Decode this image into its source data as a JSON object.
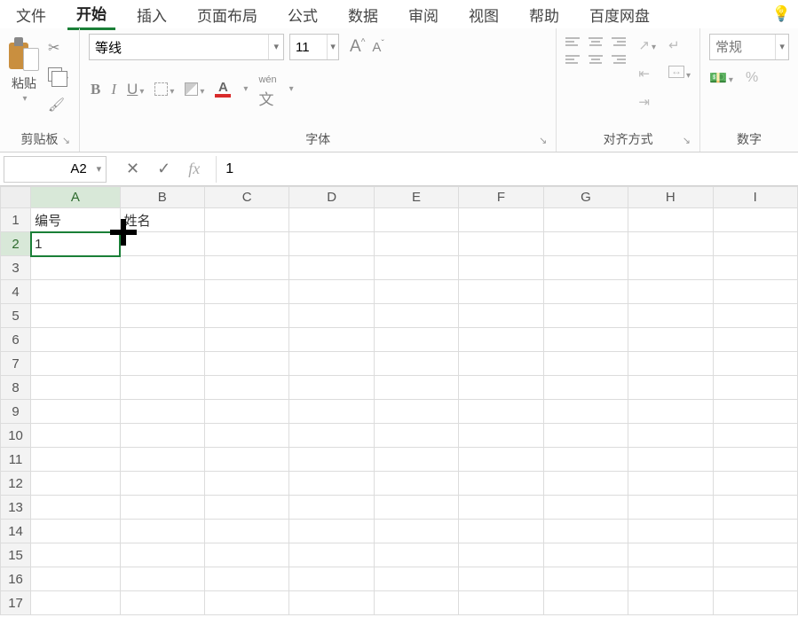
{
  "menu": {
    "tabs": [
      "文件",
      "开始",
      "插入",
      "页面布局",
      "公式",
      "数据",
      "审阅",
      "视图",
      "帮助",
      "百度网盘"
    ],
    "active_index": 1
  },
  "ribbon": {
    "clipboard": {
      "paste_label": "粘贴",
      "group_label": "剪贴板"
    },
    "font": {
      "font_name": "等线",
      "font_size": "11",
      "bold": "B",
      "italic": "I",
      "underline": "U",
      "wen": "wén",
      "group_label": "字体"
    },
    "alignment": {
      "group_label": "对齐方式"
    },
    "number": {
      "format_placeholder": "常规",
      "percent": "%",
      "group_label": "数字"
    }
  },
  "namebox": {
    "value": "A2"
  },
  "formula": {
    "value": "1",
    "cancel": "✕",
    "confirm": "✓",
    "fx": "fx"
  },
  "sheet": {
    "columns": [
      "A",
      "B",
      "C",
      "D",
      "E",
      "F",
      "G",
      "H",
      "I"
    ],
    "rows": [
      "1",
      "2",
      "3",
      "4",
      "5",
      "6",
      "7",
      "8",
      "9",
      "10",
      "11",
      "12",
      "13",
      "14",
      "15",
      "16",
      "17"
    ],
    "cells": {
      "A1": "编号",
      "B1": "姓名",
      "A2": "1"
    },
    "selected": "A2"
  }
}
